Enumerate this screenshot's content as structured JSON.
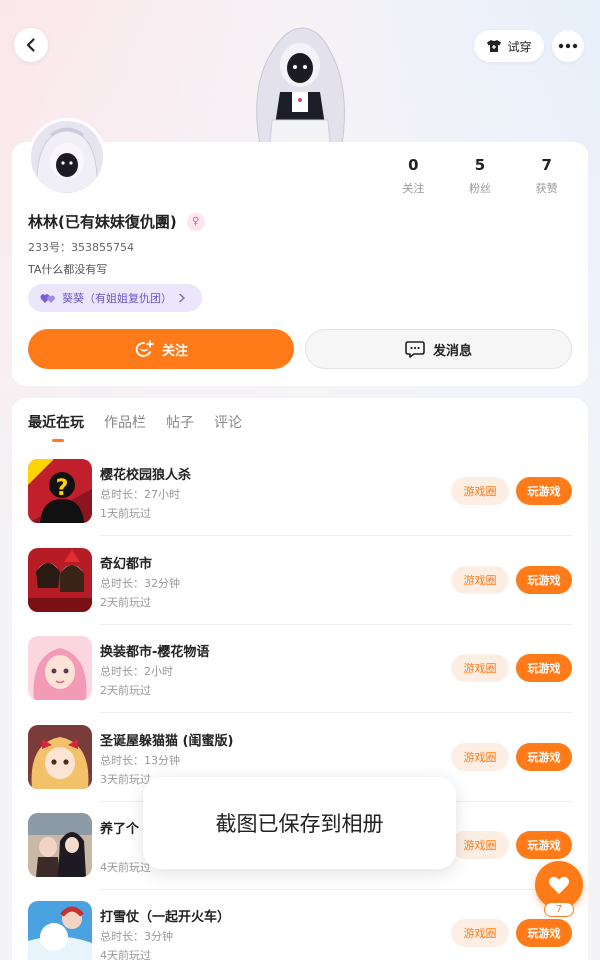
{
  "header": {
    "tryon_label": "试穿"
  },
  "profile": {
    "stats": [
      {
        "value": "0",
        "label": "关注"
      },
      {
        "value": "5",
        "label": "粉丝"
      },
      {
        "value": "7",
        "label": "获赞"
      }
    ],
    "username": "林林(已有妹妹復仇團)",
    "gender_symbol": "♀",
    "uid": "233号：353855754",
    "bio": "TA什么都没有写",
    "group_tag": "葵葵（有姐姐复仇团）",
    "follow_label": "关注",
    "message_label": "发消息"
  },
  "tabs": [
    {
      "label": "最近在玩",
      "active": true
    },
    {
      "label": "作品栏",
      "active": false
    },
    {
      "label": "帖子",
      "active": false
    },
    {
      "label": "评论",
      "active": false
    }
  ],
  "games": [
    {
      "title": "樱花校园狼人杀",
      "duration": "总时长：27小时",
      "last": "1天前玩过",
      "badge": "新地图",
      "circle": "游戏圈",
      "play": "玩游戏"
    },
    {
      "title": "奇幻都市",
      "duration": "总时长：32分钟",
      "last": "2天前玩过",
      "badge": "奇幻都市",
      "circle": "游戏圈",
      "play": "玩游戏"
    },
    {
      "title": "换装都市-樱花物语",
      "duration": "总时长：2小时",
      "last": "2天前玩过",
      "circle": "游戏圈",
      "play": "玩游戏"
    },
    {
      "title": "圣诞屋躲猫猫 (闺蜜版)",
      "duration": "总时长：13分钟",
      "last": "3天前玩过",
      "circle": "游戏圈",
      "play": "玩游戏"
    },
    {
      "title": "养了个",
      "duration": "",
      "last": "4天前玩过",
      "circle": "游戏圈",
      "play": "玩游戏"
    },
    {
      "title": "打雪仗（一起开火车）",
      "duration": "总时长：3分钟",
      "last": "4天前玩过",
      "circle": "游戏圈",
      "play": "玩游戏"
    }
  ],
  "toast": "截图已保存到相册",
  "like_count": "7",
  "colors": {
    "accent": "#ff7a18",
    "accent_soft": "#fdeee4",
    "tag_purple": "#6d56c9"
  }
}
